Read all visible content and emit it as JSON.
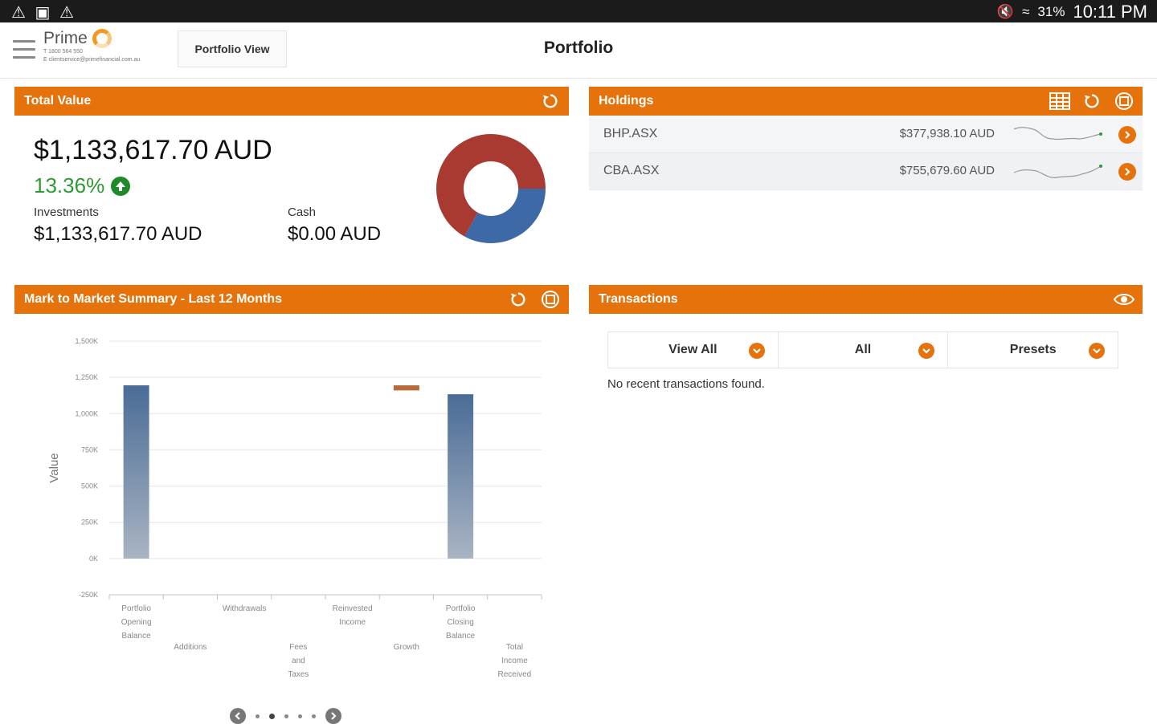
{
  "statusbar": {
    "icons": [
      "warning-icon",
      "image-icon",
      "warning-icon"
    ],
    "right_icons": [
      "mute-icon",
      "wifi-icon"
    ],
    "battery": "31%",
    "time": "10:11 PM"
  },
  "appbar": {
    "brand": "Prime",
    "phone": "T 1800 564 550",
    "email": "E clientservice@primefinancial.com.au",
    "view_button": "Portfolio View",
    "title": "Portfolio"
  },
  "total_value_panel": {
    "title": "Total Value",
    "total": "$1,133,617.70 AUD",
    "change_pct": "13.36%",
    "investments_label": "Investments",
    "investments_value": "$1,133,617.70 AUD",
    "cash_label": "Cash",
    "cash_value": "$0.00 AUD",
    "donut": {
      "red_fraction": 0.67,
      "blue_fraction": 0.33,
      "red_color": "#a83a32",
      "blue_color": "#3d6aa6"
    }
  },
  "holdings_panel": {
    "title": "Holdings",
    "rows": [
      {
        "name": "BHP.ASX",
        "value": "$377,938.10 AUD"
      },
      {
        "name": "CBA.ASX",
        "value": "$755,679.60 AUD"
      }
    ]
  },
  "mtm_panel": {
    "title": "Mark to Market Summary - Last 12 Months"
  },
  "transactions_panel": {
    "title": "Transactions",
    "filters": [
      "View All",
      "All",
      "Presets"
    ],
    "empty_message": "No recent transactions found."
  },
  "colors": {
    "accent": "#e5720a",
    "positive": "#2d9a34"
  },
  "chart_data": {
    "type": "bar",
    "ylabel": "Value",
    "ylim": [
      -250000,
      1500000
    ],
    "yticks": [
      -250000,
      0,
      250000,
      500000,
      750000,
      1000000,
      1250000,
      1500000
    ],
    "ytick_labels": [
      "-250K",
      "0K",
      "250K",
      "500K",
      "750K",
      "1,000K",
      "1,250K",
      "1,500K"
    ],
    "categories": [
      [
        "Portfolio",
        "Opening",
        "Balance"
      ],
      [
        "Additions"
      ],
      [
        "Withdrawals"
      ],
      [
        "Fees",
        "and",
        "Taxes"
      ],
      [
        "Reinvested",
        "Income"
      ],
      [
        "Growth"
      ],
      [
        "Portfolio",
        "Closing",
        "Balance"
      ],
      [
        "Total",
        "Income",
        "Received"
      ]
    ],
    "bars": [
      {
        "base": 0,
        "top": 1195000,
        "kind": "total"
      },
      null,
      null,
      null,
      null,
      {
        "base": 1160000,
        "top": 1195000,
        "kind": "delta"
      },
      {
        "base": 0,
        "top": 1133617.7,
        "kind": "total"
      },
      null
    ],
    "grid": true
  },
  "pager": {
    "pages": 5,
    "active": 1
  }
}
